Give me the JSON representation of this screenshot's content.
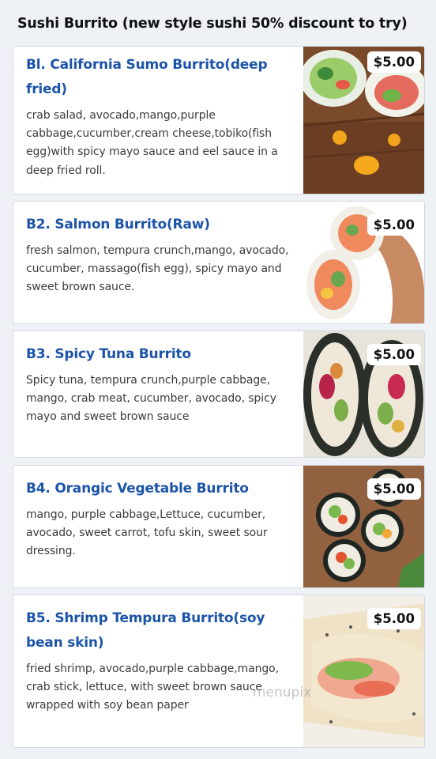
{
  "title": "Sushi Burrito (new style sushi 50% discount to try)",
  "items": [
    {
      "name": "Bl. California Sumo Burrito(deep fried)",
      "description": "crab salad, avocado,mango,purple cabbage,cucumber,cream cheese,tobiko(fish egg)with spicy mayo sauce and eel sauce in a deep fried roll.",
      "price": "$5.00"
    },
    {
      "name": "B2. Salmon Burrito(Raw)",
      "description": "fresh salmon, tempura crunch,mango, avocado, cucumber, massago(fish egg), spicy mayo and sweet brown sauce.",
      "price": "$5.00"
    },
    {
      "name": "B3. Spicy Tuna Burrito",
      "description": "Spicy tuna, tempura crunch,purple cabbage, mango, crab meat, cucumber, avocado, spicy mayo and sweet brown sauce",
      "price": "$5.00"
    },
    {
      "name": "B4. Orangic Vegetable Burrito",
      "description": "mango, purple cabbage,Lettuce, cucumber, avocado, sweet carrot, tofu skin, sweet sour dressing.",
      "price": "$5.00"
    },
    {
      "name": "B5. Shrimp Tempura Burrito(soy bean skin)",
      "description": "fried shrimp, avocado,purple cabbage,mango, crab stick, lettuce, with sweet brown sauce wrapped with soy bean paper",
      "price": "$5.00"
    }
  ],
  "watermark": "menupix"
}
